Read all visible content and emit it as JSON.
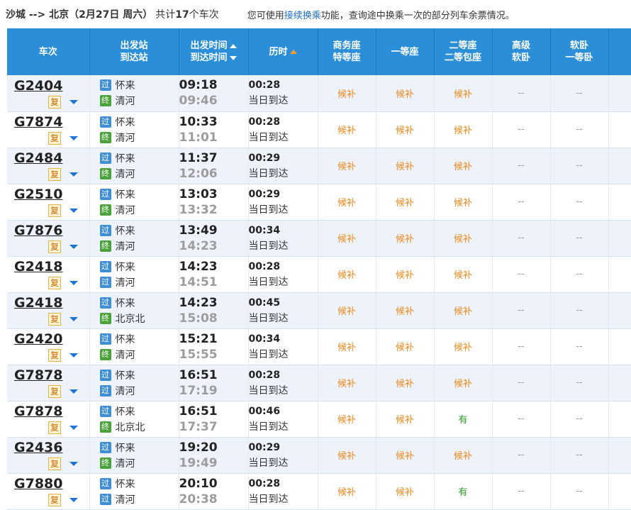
{
  "topbar": {
    "route": "沙城 --> 北京（2月27日  周六）",
    "total_prefix": "共计",
    "total_count": "17",
    "total_suffix": "个车次",
    "notice_prefix": "您可使用",
    "notice_link": "接续换乘",
    "notice_suffix": "功能，查询途中换乘一次的部分列车余票情况。"
  },
  "headers": {
    "train": "车次",
    "stations_1": "出发站",
    "stations_2": "到达站",
    "time_1": "出发时间",
    "time_2": "到达时间",
    "duration": "历时",
    "business_1": "商务座",
    "business_2": "特等座",
    "first": "一等座",
    "second_1": "二等座",
    "second_2": "二等包座",
    "senior_1": "高级",
    "senior_2": "软卧",
    "softsleeper_1": "软卧",
    "softsleeper_2": "一等卧"
  },
  "labels": {
    "fu": "复",
    "badge_pass": "过",
    "badge_end": "终"
  },
  "trains": [
    {
      "num": "G2404",
      "from": "怀来",
      "to": "清河",
      "to_badge": "终",
      "dep": "09:18",
      "arr": "09:46",
      "dur": "00:28",
      "day": "当日到达",
      "business": "候补",
      "first": "候补",
      "second": "候补",
      "senior": "--",
      "soft": "--"
    },
    {
      "num": "G7874",
      "from": "怀来",
      "to": "清河",
      "to_badge": "终",
      "dep": "10:33",
      "arr": "11:01",
      "dur": "00:28",
      "day": "当日到达",
      "business": "候补",
      "first": "候补",
      "second": "候补",
      "senior": "--",
      "soft": "--"
    },
    {
      "num": "G2484",
      "from": "怀来",
      "to": "清河",
      "to_badge": "终",
      "dep": "11:37",
      "arr": "12:06",
      "dur": "00:29",
      "day": "当日到达",
      "business": "候补",
      "first": "候补",
      "second": "候补",
      "senior": "--",
      "soft": "--"
    },
    {
      "num": "G2510",
      "from": "怀来",
      "to": "清河",
      "to_badge": "终",
      "dep": "13:03",
      "arr": "13:32",
      "dur": "00:29",
      "day": "当日到达",
      "business": "候补",
      "first": "候补",
      "second": "候补",
      "senior": "--",
      "soft": "--"
    },
    {
      "num": "G7876",
      "from": "怀来",
      "to": "清河",
      "to_badge": "终",
      "dep": "13:49",
      "arr": "14:23",
      "dur": "00:34",
      "day": "当日到达",
      "business": "候补",
      "first": "候补",
      "second": "候补",
      "senior": "--",
      "soft": "--"
    },
    {
      "num": "G2418",
      "from": "怀来",
      "to": "清河",
      "to_badge": "过",
      "dep": "14:23",
      "arr": "14:51",
      "dur": "00:28",
      "day": "当日到达",
      "business": "候补",
      "first": "候补",
      "second": "候补",
      "senior": "--",
      "soft": "--"
    },
    {
      "num": "G2418",
      "from": "怀来",
      "to": "北京北",
      "to_badge": "终",
      "dep": "14:23",
      "arr": "15:08",
      "dur": "00:45",
      "day": "当日到达",
      "business": "候补",
      "first": "候补",
      "second": "候补",
      "senior": "--",
      "soft": "--"
    },
    {
      "num": "G2420",
      "from": "怀来",
      "to": "清河",
      "to_badge": "终",
      "dep": "15:21",
      "arr": "15:55",
      "dur": "00:34",
      "day": "当日到达",
      "business": "候补",
      "first": "候补",
      "second": "候补",
      "senior": "--",
      "soft": "--"
    },
    {
      "num": "G7878",
      "from": "怀来",
      "to": "清河",
      "to_badge": "过",
      "dep": "16:51",
      "arr": "17:19",
      "dur": "00:28",
      "day": "当日到达",
      "business": "候补",
      "first": "候补",
      "second": "候补",
      "senior": "--",
      "soft": "--"
    },
    {
      "num": "G7878",
      "from": "怀来",
      "to": "北京北",
      "to_badge": "终",
      "dep": "16:51",
      "arr": "17:37",
      "dur": "00:46",
      "day": "当日到达",
      "business": "候补",
      "first": "候补",
      "second": "有",
      "senior": "--",
      "soft": "--"
    },
    {
      "num": "G2436",
      "from": "怀来",
      "to": "清河",
      "to_badge": "终",
      "dep": "19:20",
      "arr": "19:49",
      "dur": "00:29",
      "day": "当日到达",
      "business": "候补",
      "first": "候补",
      "second": "候补",
      "senior": "--",
      "soft": "--"
    },
    {
      "num": "G7880",
      "from": "怀来",
      "to": "清河",
      "to_badge": "过",
      "dep": "20:10",
      "arr": "20:38",
      "dur": "00:28",
      "day": "当日到达",
      "business": "候补",
      "first": "候补",
      "second": "有",
      "senior": "--",
      "soft": "--"
    }
  ],
  "colors": {
    "header_bg": "#2a8fd8",
    "row_alt": "#eef3fb",
    "waitlist": "#f08a1e",
    "available": "#2a9a2a",
    "link": "#1e6fc8",
    "sort_active": "#ff9a2a"
  }
}
